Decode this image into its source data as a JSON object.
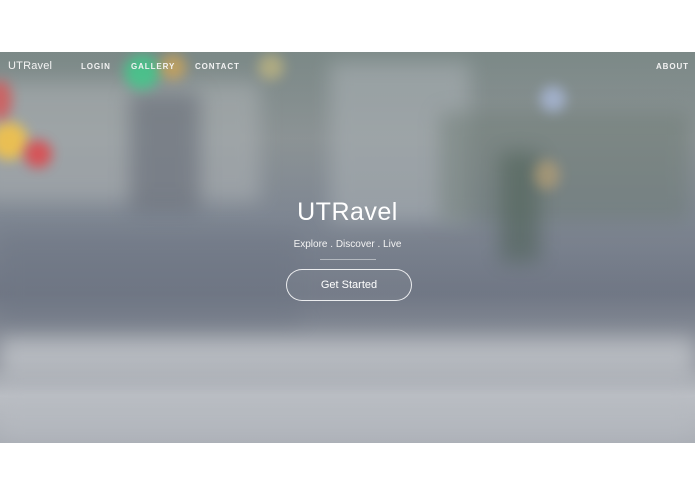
{
  "nav": {
    "logo": "UTRavel",
    "links": [
      {
        "label": "LOGIN"
      },
      {
        "label": "GALLERY"
      },
      {
        "label": "CONTACT"
      },
      {
        "label": "ABOUT"
      }
    ]
  },
  "hero": {
    "title": "UTRavel",
    "tagline": "Explore . Discover . Live",
    "cta_label": "Get Started"
  },
  "colors": {
    "text": "#ffffff",
    "background_tint": "#8b8f98"
  }
}
